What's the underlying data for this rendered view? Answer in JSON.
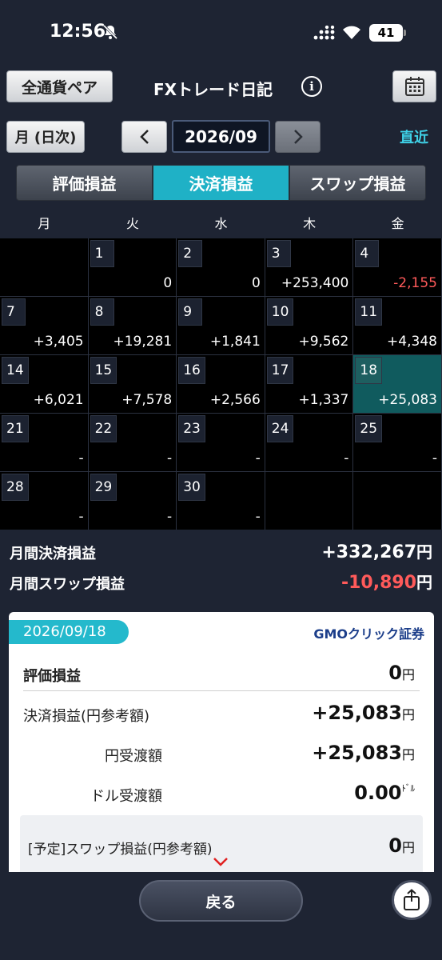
{
  "status_bar": {
    "time": "12:56",
    "battery": "41"
  },
  "header": {
    "currency_pair_label": "全通貨ペア",
    "title": "FXトレード日記",
    "info_symbol": "i"
  },
  "nav": {
    "period_label": "月 (日次)",
    "month": "2026/09",
    "latest_label": "直近"
  },
  "tabs": [
    {
      "label": "評価損益",
      "active": false
    },
    {
      "label": "決済損益",
      "active": true
    },
    {
      "label": "スワップ損益",
      "active": false
    }
  ],
  "calendar": {
    "weekdays": [
      "月",
      "火",
      "水",
      "木",
      "金"
    ],
    "weeks": [
      [
        {
          "day": "",
          "value": ""
        },
        {
          "day": "1",
          "value": "0"
        },
        {
          "day": "2",
          "value": "0"
        },
        {
          "day": "3",
          "value": "+253,400"
        },
        {
          "day": "4",
          "value": "-2,155",
          "negative": true
        }
      ],
      [
        {
          "day": "7",
          "value": "+3,405"
        },
        {
          "day": "8",
          "value": "+19,281"
        },
        {
          "day": "9",
          "value": "+1,841"
        },
        {
          "day": "10",
          "value": "+9,562"
        },
        {
          "day": "11",
          "value": "+4,348"
        }
      ],
      [
        {
          "day": "14",
          "value": "+6,021"
        },
        {
          "day": "15",
          "value": "+7,578"
        },
        {
          "day": "16",
          "value": "+2,566"
        },
        {
          "day": "17",
          "value": "+1,337"
        },
        {
          "day": "18",
          "value": "+25,083",
          "selected": true
        }
      ],
      [
        {
          "day": "21",
          "value": "-"
        },
        {
          "day": "22",
          "value": "-"
        },
        {
          "day": "23",
          "value": "-"
        },
        {
          "day": "24",
          "value": "-"
        },
        {
          "day": "25",
          "value": "-"
        }
      ],
      [
        {
          "day": "28",
          "value": "-"
        },
        {
          "day": "29",
          "value": "-"
        },
        {
          "day": "30",
          "value": "-"
        },
        {
          "day": "",
          "value": ""
        },
        {
          "day": "",
          "value": ""
        }
      ]
    ]
  },
  "summary": {
    "monthly_settlement_label": "月間決済損益",
    "monthly_settlement_value": "+332,267",
    "monthly_swap_label": "月間スワップ損益",
    "monthly_swap_value": "-10,890",
    "yen_unit": "円"
  },
  "detail": {
    "date": "2026/09/18",
    "broker": {
      "prefix": "GMO",
      "suffix": "クリック証券"
    },
    "valuation_label": "評価損益",
    "valuation_value": "0",
    "settlement_label": "決済損益(円参考額)",
    "settlement_value": "+25,083",
    "yen_transfer_label": "円受渡額",
    "yen_transfer_value": "+25,083",
    "dollar_transfer_label": "ドル受渡額",
    "dollar_transfer_value": "0.00",
    "dollar_unit": "ﾄﾞﾙ",
    "scheduled_swap_label": "[予定]スワップ損益(円参考額)",
    "scheduled_swap_value": "0",
    "yen_unit": "円"
  },
  "footer": {
    "back_label": "戻る"
  }
}
